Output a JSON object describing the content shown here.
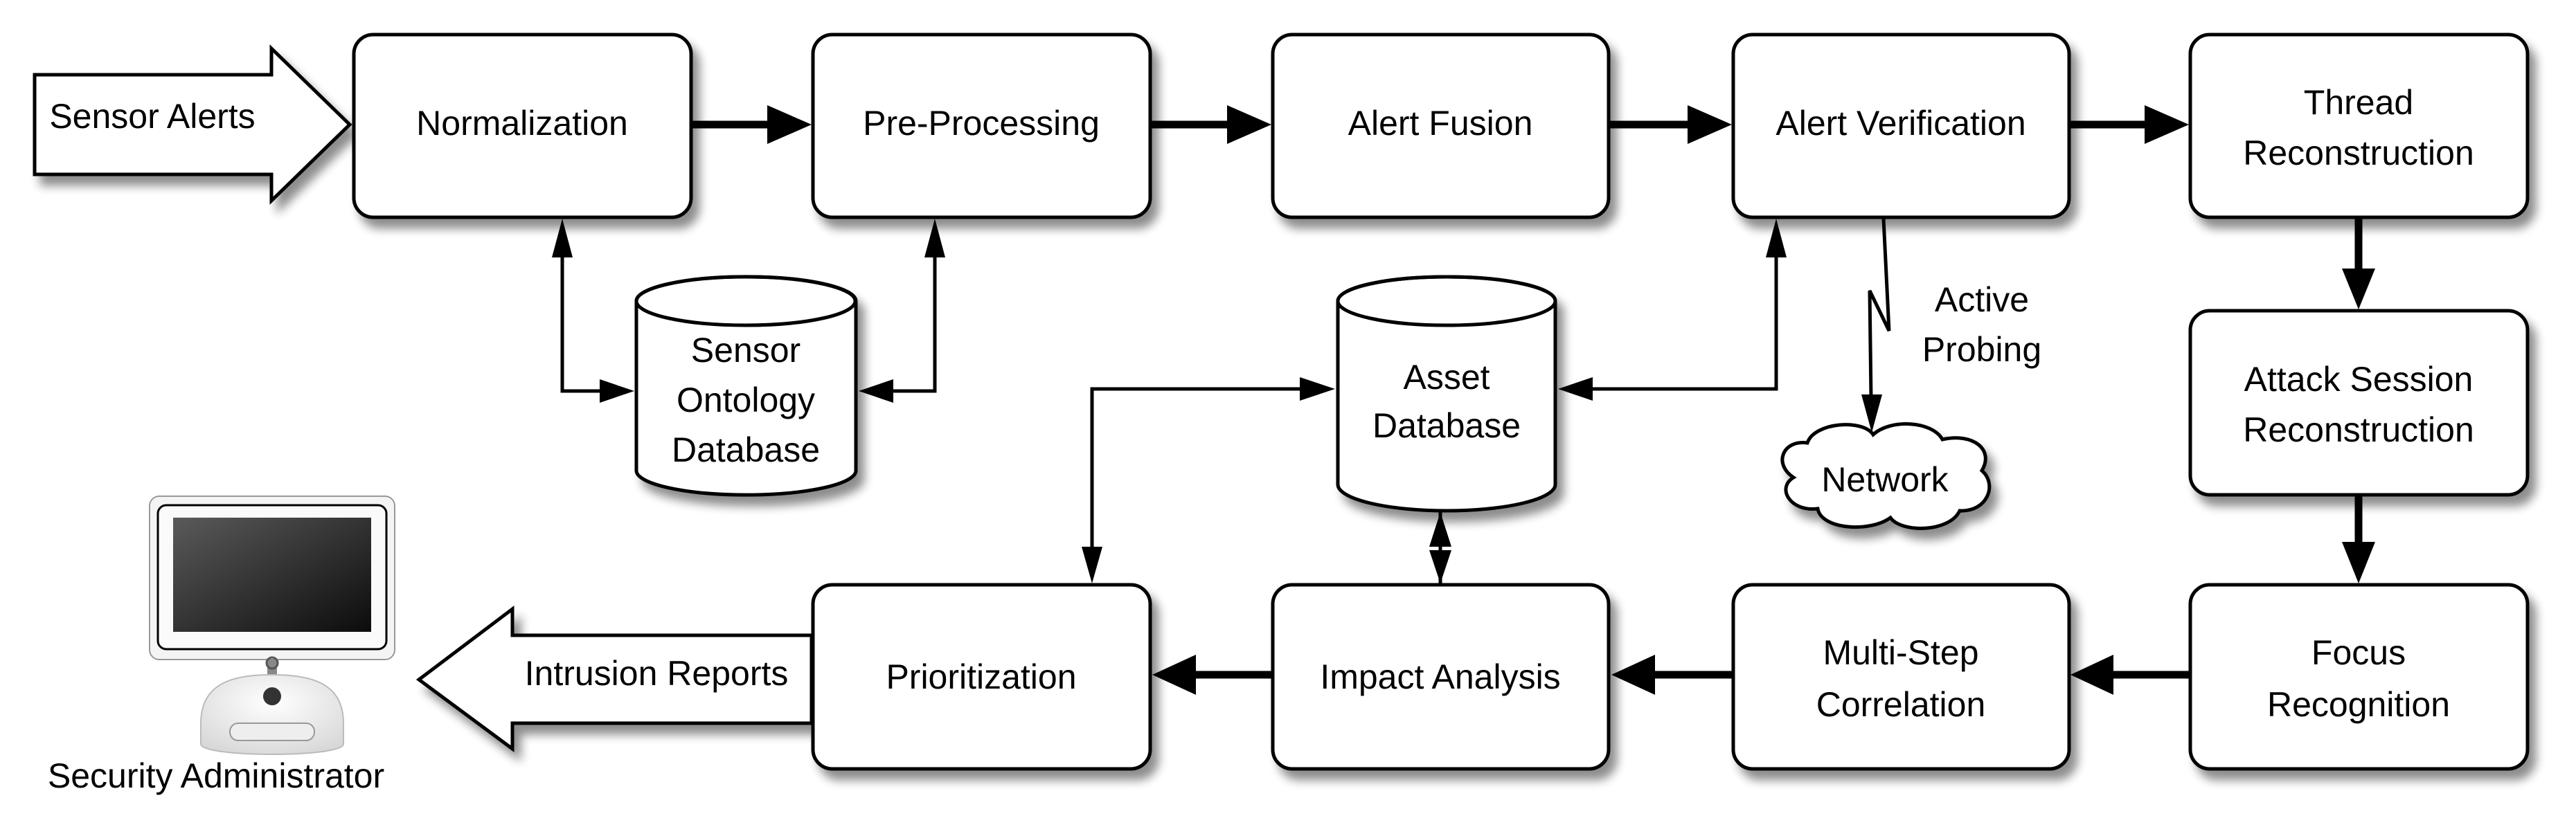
{
  "diagram": {
    "input_arrow": {
      "label": "Sensor Alerts"
    },
    "output_arrow": {
      "label": "Intrusion Reports"
    },
    "actor": {
      "label": "Security Administrator",
      "icon": "desktop-computer-icon"
    },
    "process_boxes": [
      {
        "id": "normalization",
        "lines": [
          "Normalization"
        ]
      },
      {
        "id": "pre-processing",
        "lines": [
          "Pre-Processing"
        ]
      },
      {
        "id": "alert-fusion",
        "lines": [
          "Alert Fusion"
        ]
      },
      {
        "id": "alert-verification",
        "lines": [
          "Alert Verification"
        ]
      },
      {
        "id": "thread-reconstruction",
        "lines": [
          "Thread",
          "Reconstruction"
        ]
      },
      {
        "id": "attack-session-reconstruction",
        "lines": [
          "Attack Session",
          "Reconstruction"
        ]
      },
      {
        "id": "focus-recognition",
        "lines": [
          "Focus",
          "Recognition"
        ]
      },
      {
        "id": "multi-step-correlation",
        "lines": [
          "Multi-Step",
          "Correlation"
        ]
      },
      {
        "id": "impact-analysis",
        "lines": [
          "Impact Analysis"
        ]
      },
      {
        "id": "prioritization",
        "lines": [
          "Prioritization"
        ]
      }
    ],
    "databases": [
      {
        "id": "sensor-ontology-database",
        "lines": [
          "Sensor",
          "Ontology",
          "Database"
        ]
      },
      {
        "id": "asset-database",
        "lines": [
          "Asset",
          "Database"
        ]
      }
    ],
    "cloud": {
      "id": "network",
      "label": "Network"
    },
    "annotation": {
      "lines": [
        "Active",
        "Probing"
      ]
    },
    "edges": [
      {
        "from": "Sensor Alerts",
        "to": "Normalization"
      },
      {
        "from": "Normalization",
        "to": "Pre-Processing"
      },
      {
        "from": "Pre-Processing",
        "to": "Alert Fusion"
      },
      {
        "from": "Alert Fusion",
        "to": "Alert Verification"
      },
      {
        "from": "Alert Verification",
        "to": "Thread Reconstruction"
      },
      {
        "from": "Thread Reconstruction",
        "to": "Attack Session Reconstruction"
      },
      {
        "from": "Attack Session Reconstruction",
        "to": "Focus Recognition"
      },
      {
        "from": "Focus Recognition",
        "to": "Multi-Step Correlation"
      },
      {
        "from": "Multi-Step Correlation",
        "to": "Impact Analysis"
      },
      {
        "from": "Impact Analysis",
        "to": "Prioritization"
      },
      {
        "from": "Prioritization",
        "to": "Security Administrator"
      },
      {
        "from": "Normalization",
        "to": "Sensor Ontology Database",
        "bidirectional": true
      },
      {
        "from": "Pre-Processing",
        "to": "Sensor Ontology Database",
        "bidirectional": true
      },
      {
        "from": "Alert Verification",
        "to": "Asset Database",
        "bidirectional": true
      },
      {
        "from": "Prioritization",
        "to": "Asset Database",
        "bidirectional": true
      },
      {
        "from": "Impact Analysis",
        "to": "Asset Database",
        "bidirectional": true
      },
      {
        "from": "Alert Verification",
        "to": "Network",
        "label": "Active Probing"
      }
    ]
  }
}
